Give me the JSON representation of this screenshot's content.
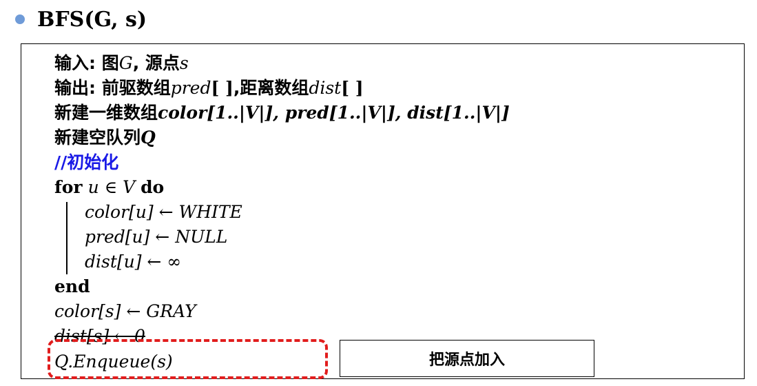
{
  "header": {
    "title": "BFS(G, s)"
  },
  "algorithm": {
    "input_label": "输入: 图",
    "input_graph": "G",
    "input_sep": ", 源点",
    "input_source": "s",
    "output_label": "输出: 前驱数组",
    "output_pred": "pred",
    "output_brackets1": "[ ]",
    "output_sep": ",距离数组",
    "output_dist": "dist",
    "output_brackets2": "[ ]",
    "create_arrays_label": "新建一维数组",
    "create_arrays_expr": "color[1..|V|], pred[1..|V|], dist[1..|V|]",
    "create_queue_label": "新建空队列",
    "create_queue_var": "Q",
    "comment_init": "//初始化",
    "for_kw": "for",
    "for_expr": "u ∈ V",
    "do_kw": "do",
    "loop_body": [
      "color[u] ← WHITE",
      "pred[u] ← NULL",
      "dist[u] ← ∞"
    ],
    "end_kw": "end",
    "after_loop": [
      "color[s] ← GRAY",
      "dist[s] ← 0",
      "Q.Enqueue(s)"
    ]
  },
  "callout": {
    "label": "把源点加入"
  },
  "colors": {
    "comment": "#1a1ae6",
    "highlight_dash": "#e11d1d",
    "bullet": "#6f9bd8"
  }
}
